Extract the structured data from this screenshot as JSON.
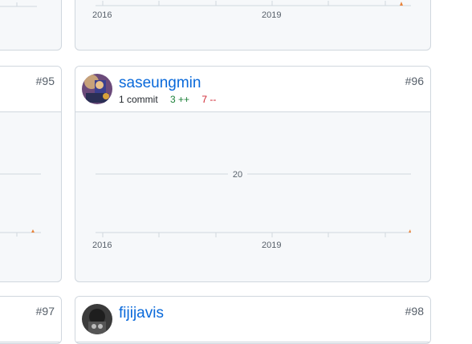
{
  "cards": {
    "top_left": {},
    "top_right": {
      "tick_labels": [
        "2016",
        "2019"
      ]
    },
    "mid_left": {
      "rank": "#95"
    },
    "mid_right": {
      "rank": "#96",
      "username": "saseungmin",
      "commits": "1 commit",
      "additions": "3 ++",
      "deletions": "7 --",
      "chart_label": "20",
      "tick_labels": [
        "2016",
        "2019"
      ]
    },
    "bottom_left": {
      "rank": "#97"
    },
    "bottom_right": {
      "rank": "#98",
      "username": "fijijavis"
    }
  },
  "colors": {
    "accent": "#0969da",
    "add": "#1a7f37",
    "del": "#cf222e",
    "spike": "#e8833a"
  }
}
